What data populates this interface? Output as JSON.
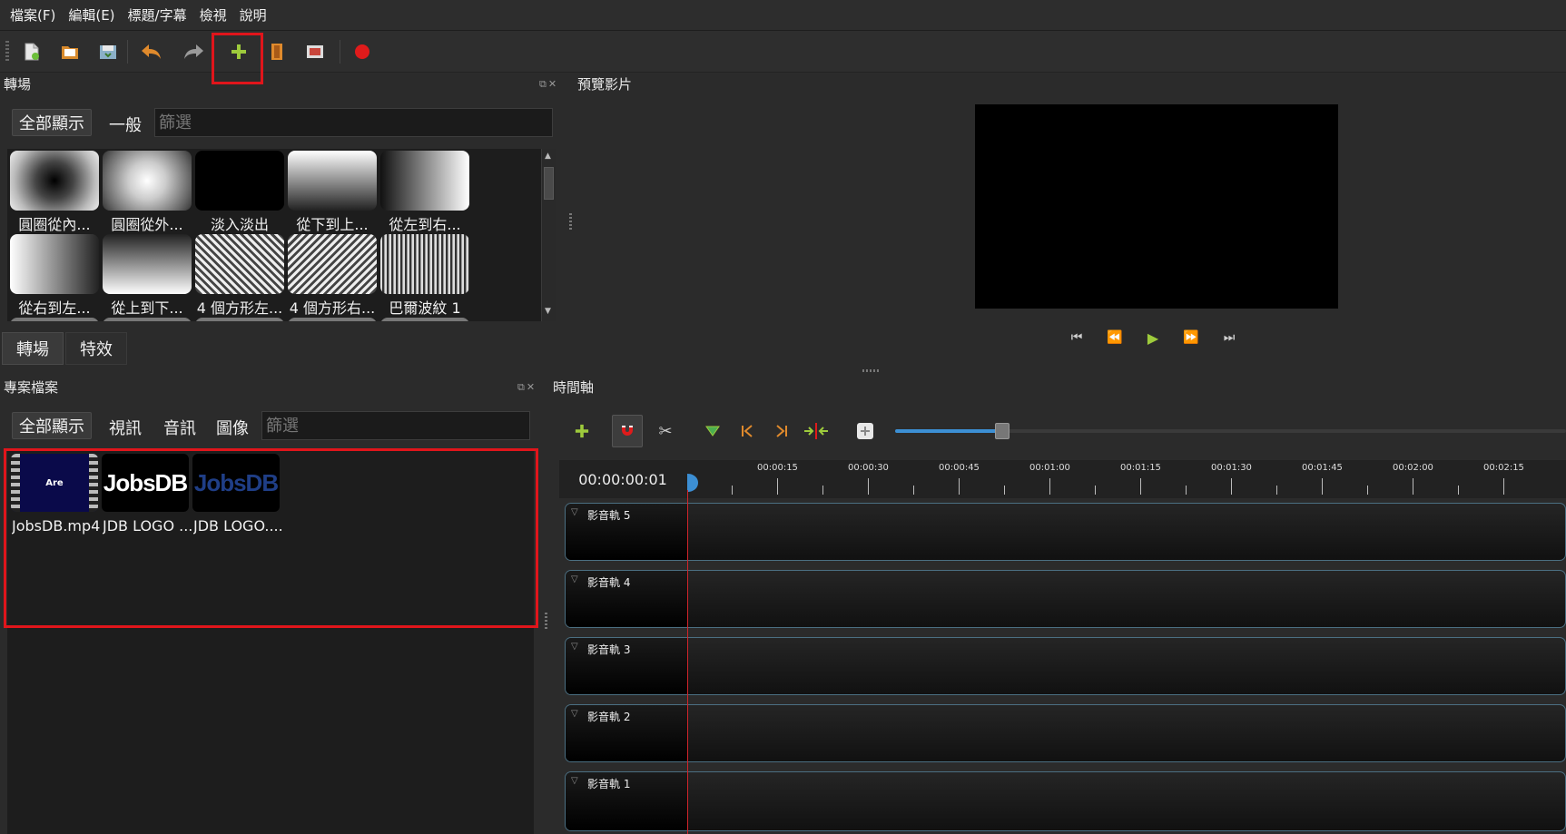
{
  "menu": [
    "檔案(F)",
    "編輯(E)",
    "標題/字幕",
    "檢視",
    "說明"
  ],
  "colors": {
    "accent_green": "#9ecb3c",
    "highlight_red": "#e0151b",
    "record_red": "#e01b1b"
  },
  "transitions_panel": {
    "title": "轉場",
    "filter_all": "全部顯示",
    "filter_general": "一般",
    "filter_placeholder": "篩選",
    "items": [
      {
        "label": "圓圈從內..."
      },
      {
        "label": "圓圈從外..."
      },
      {
        "label": "淡入淡出"
      },
      {
        "label": "從下到上..."
      },
      {
        "label": "從左到右..."
      },
      {
        "label": "從右到左..."
      },
      {
        "label": "從上到下..."
      },
      {
        "label": "4 個方形左..."
      },
      {
        "label": "4 個方形右..."
      },
      {
        "label": "巴爾波紋 1"
      }
    ]
  },
  "tabs": [
    "轉場",
    "特效"
  ],
  "project_panel": {
    "title": "專案檔案",
    "filter_all": "全部顯示",
    "filter_video": "視訊",
    "filter_audio": "音訊",
    "filter_image": "圖像",
    "filter_placeholder": "篩選",
    "files": [
      {
        "label": "JobsDB.mp4",
        "thumb_text": "Are"
      },
      {
        "label": "JDB LOGO ...",
        "thumb_text": "JobsDB"
      },
      {
        "label": "JDB LOGO....",
        "thumb_text": "JobsDB"
      }
    ]
  },
  "preview_panel": {
    "title": "預覽影片"
  },
  "timeline_panel": {
    "title": "時間軸",
    "current_time": "00:00:00:01",
    "ticks": [
      "00:00:15",
      "00:00:30",
      "00:00:45",
      "00:01:00",
      "00:01:15",
      "00:01:30",
      "00:01:45",
      "00:02:00",
      "00:02:15"
    ],
    "tracks": [
      "影音軌 5",
      "影音軌 4",
      "影音軌 3",
      "影音軌 2",
      "影音軌 1"
    ]
  }
}
